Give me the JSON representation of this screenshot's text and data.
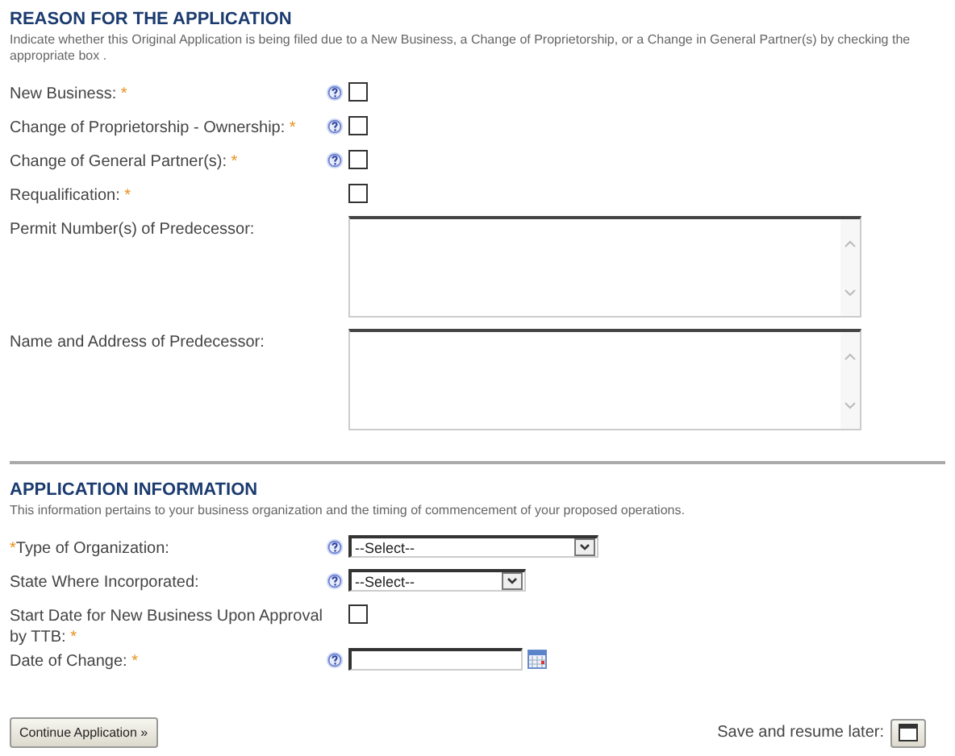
{
  "sections": [
    {
      "title": "REASON FOR THE APPLICATION",
      "description": "Indicate whether this Original Application is being filed due to a New  Business, a Change of Proprietorship, or a Change in General Partner(s) by checking the appropriate box .",
      "fields": [
        {
          "kind": "checkbox",
          "label": "New Business:",
          "required_mark": "*",
          "help": true,
          "checked": false
        },
        {
          "kind": "checkbox",
          "label": "Change of Proprietorship - Ownership:",
          "required_mark": "*",
          "help": true,
          "checked": false
        },
        {
          "kind": "checkbox",
          "label": "Change of General Partner(s):",
          "required_mark": "*",
          "help": true,
          "checked": false
        },
        {
          "kind": "checkbox",
          "label": "Requalification:",
          "required_mark": "*",
          "help": false,
          "checked": false
        },
        {
          "kind": "textarea",
          "label": "Permit Number(s) of Predecessor:",
          "help": false
        },
        {
          "kind": "textarea",
          "label": "Name and Address of Predecessor:",
          "help": false
        }
      ]
    },
    {
      "title": "APPLICATION INFORMATION",
      "description": "This information pertains to your business organization and the timing of commencement of your proposed operations.",
      "fields": [
        {
          "kind": "select",
          "label": "Type of Organization:",
          "leading_mark": "*",
          "help": true,
          "value": "--Select--"
        },
        {
          "kind": "shortselect",
          "label": "State Where Incorporated:",
          "help": true,
          "value": "--Select--"
        },
        {
          "kind": "checkbox",
          "label": "Start Date for New Business Upon Approval by TTB:",
          "required_mark": "*",
          "help": false,
          "checked": false
        },
        {
          "kind": "date",
          "label": "Date of Change:",
          "required_mark": "*",
          "help": true
        }
      ]
    }
  ],
  "continue_button": "Continue Application »",
  "save_label": "Save and resume later:"
}
